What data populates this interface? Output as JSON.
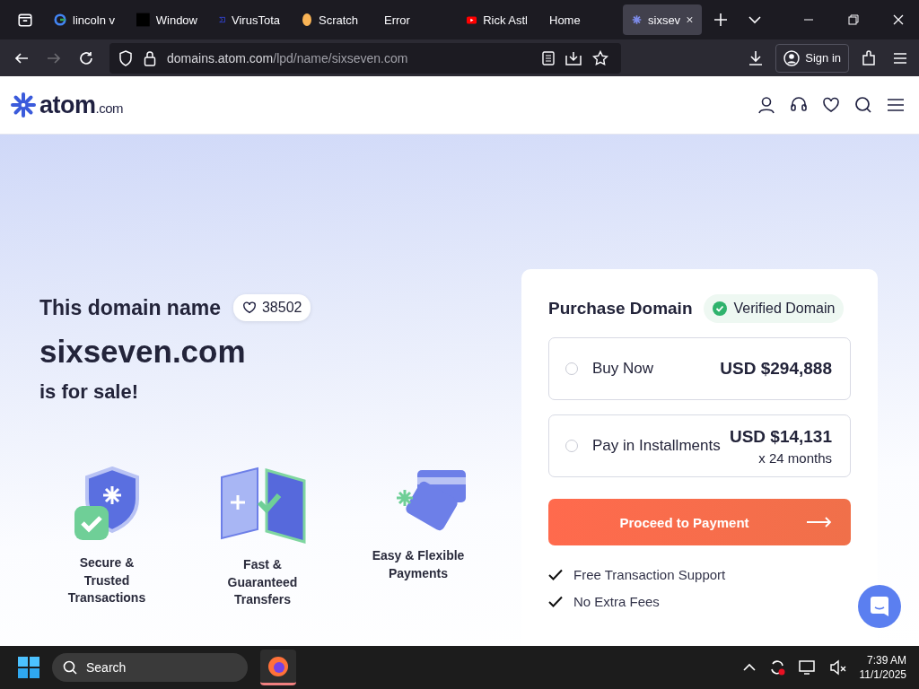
{
  "browser": {
    "tabs": [
      {
        "label": "lincoln v",
        "kind": "google",
        "selected": false
      },
      {
        "label": "Window",
        "kind": "dark",
        "selected": false
      },
      {
        "label": "VirusTota",
        "kind": "virustotal",
        "selected": false
      },
      {
        "label": "Scratch",
        "kind": "scratch",
        "selected": false
      },
      {
        "label": "Error",
        "kind": "plain",
        "selected": false
      },
      {
        "label": "Rick Astl",
        "kind": "youtube",
        "selected": false
      },
      {
        "label": "Home",
        "kind": "plain",
        "selected": false
      },
      {
        "label": "sixsev",
        "kind": "atom",
        "selected": true
      }
    ],
    "url_host": "domains.atom.com",
    "url_path": "/lpd/name/sixseven.com",
    "sign_in": "Sign in"
  },
  "site": {
    "logo_main": "atom",
    "logo_suffix": ".com"
  },
  "hero": {
    "line1": "This domain name",
    "likes": "38502",
    "domain": "sixseven.com",
    "line3": "is for sale!",
    "features": [
      {
        "kind": "shield",
        "label": "Secure & Trusted Transactions"
      },
      {
        "kind": "transfer",
        "label": "Fast & Guaranteed Transfers"
      },
      {
        "kind": "cards",
        "label": "Easy & Flexible Payments"
      }
    ]
  },
  "purchase": {
    "title": "Purchase Domain",
    "badge": "Verified Domain",
    "options": [
      {
        "label": "Buy Now",
        "price": "USD $294,888",
        "selected": false
      },
      {
        "label": "Pay in Installments",
        "price": "USD $14,131",
        "note": "x 24 months",
        "selected": false
      }
    ],
    "button": "Proceed to Payment",
    "perks": [
      "Free Transaction Support",
      "No Extra Fees"
    ]
  },
  "taskbar": {
    "search": "Search",
    "time": "7:39 AM",
    "date": "11/1/2025"
  }
}
